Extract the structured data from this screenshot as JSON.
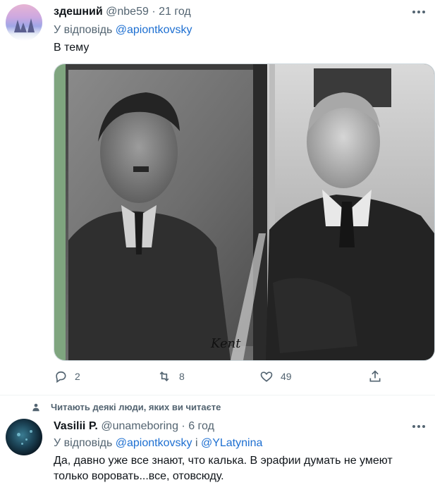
{
  "tweet1": {
    "name": "здешний",
    "handle": "@nbe59",
    "sep": "·",
    "time": "21 год",
    "reply_prefix": "У відповідь",
    "reply_to": "@apiontkovsky",
    "text": "В тему",
    "image_signature": "Kent",
    "stats": {
      "replies": "2",
      "retweets": "8",
      "likes": "49"
    }
  },
  "social_context": "Читають деякі люди, яких ви читаєте",
  "tweet2": {
    "name": "Vasilii P.",
    "handle": "@unameboring",
    "sep": "·",
    "time": "6 год",
    "reply_prefix": "У відповідь",
    "reply_to_1": "@apiontkovsky",
    "reply_and": "і",
    "reply_to_2": "@YLatynina",
    "text_line1": "Да, давно уже все знают, что калька. В эрафии думать не умеют",
    "text_line2": "только воровать...все, отовсюду."
  },
  "icons": [
    "reply-icon",
    "retweet-icon",
    "like-icon",
    "share-icon",
    "more-icon",
    "person-icon"
  ]
}
